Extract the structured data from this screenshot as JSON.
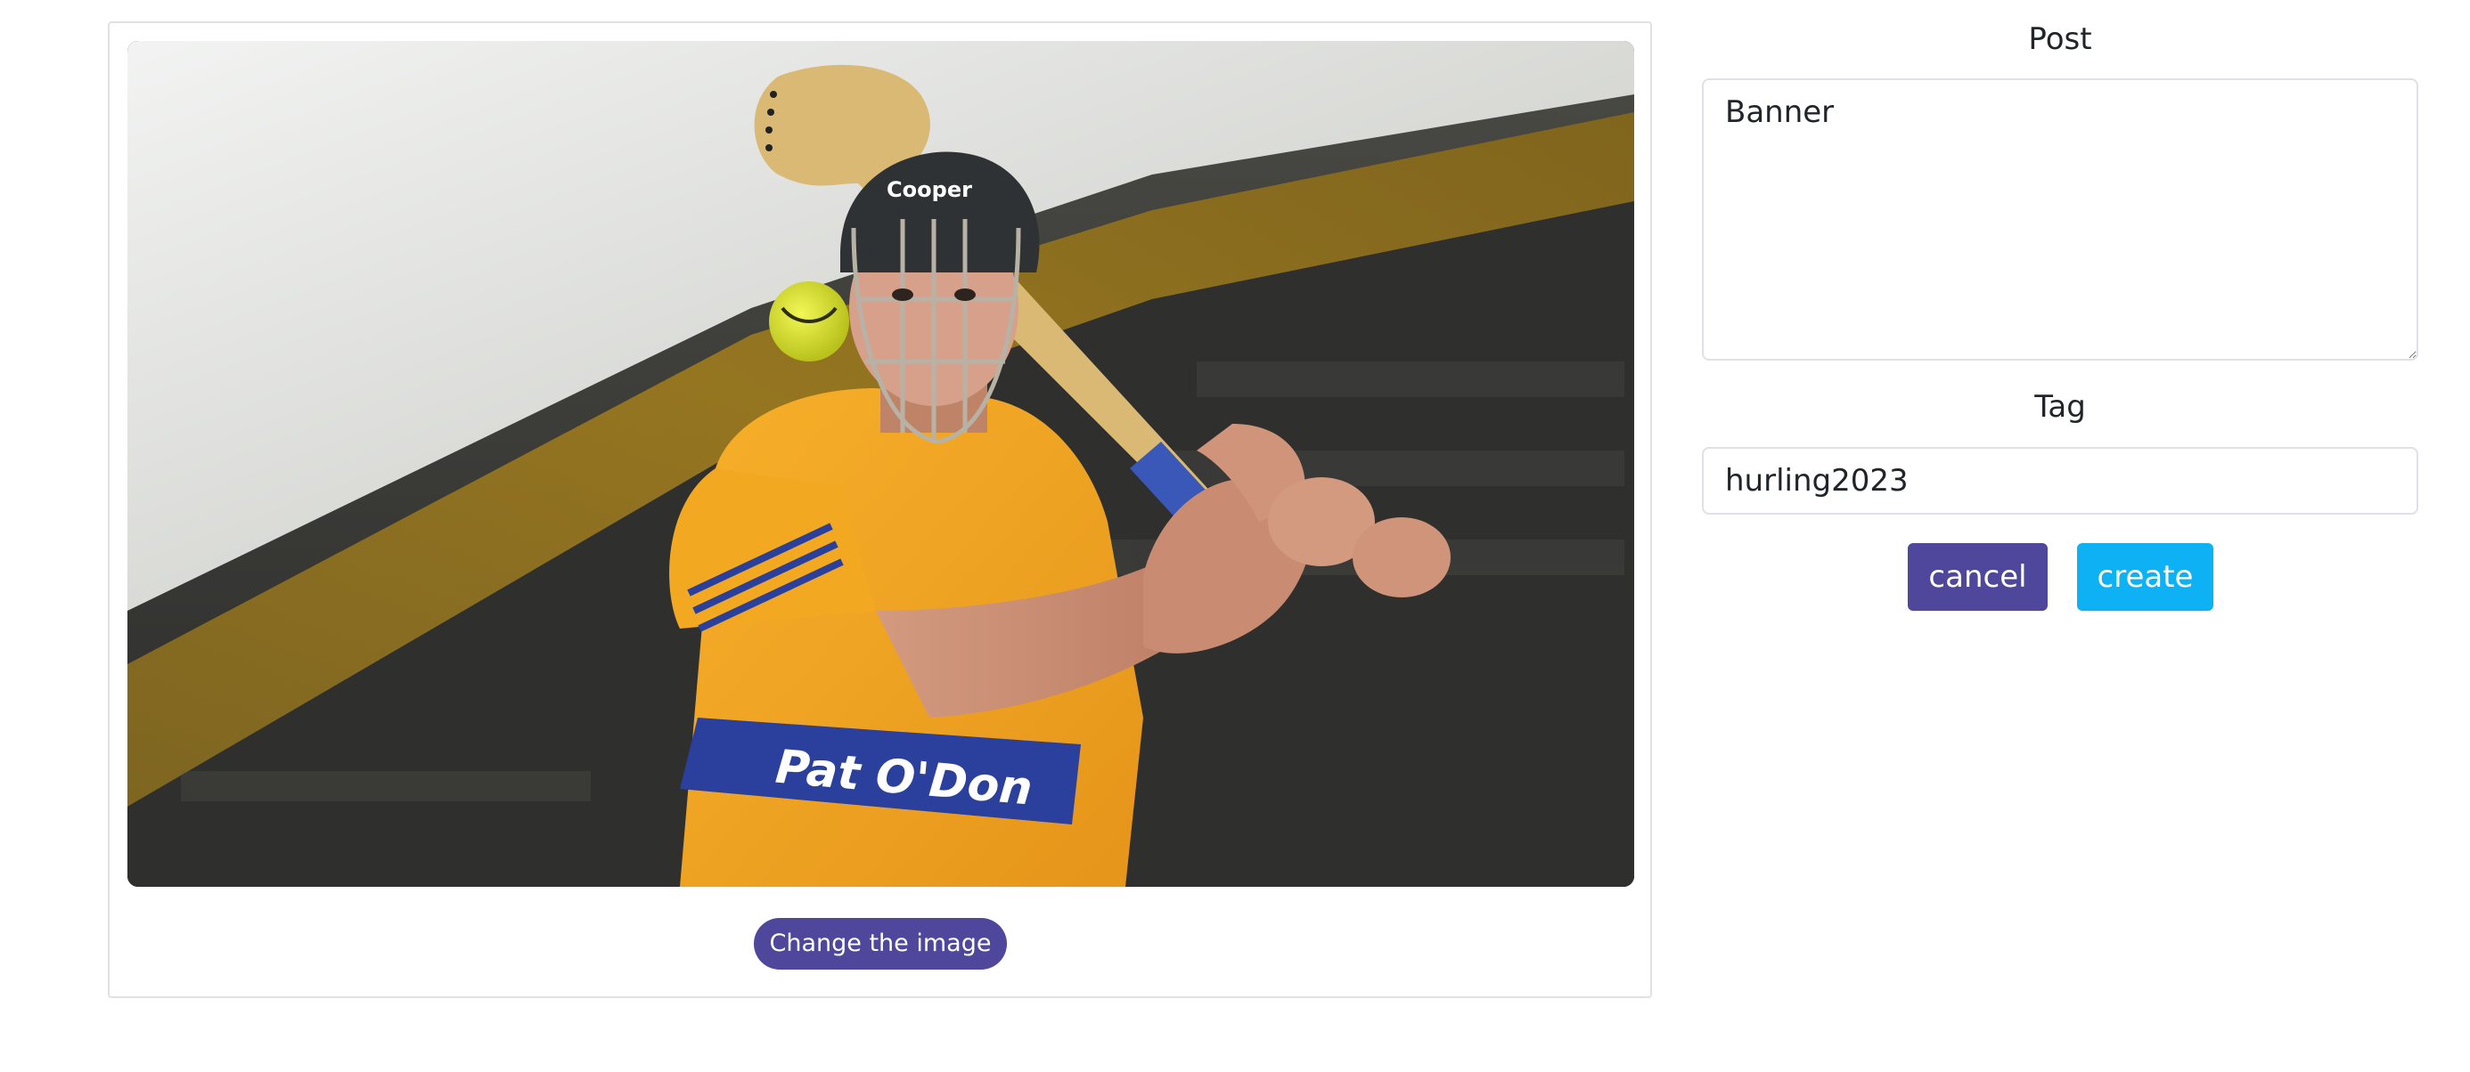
{
  "image_panel": {
    "photo_alt": "Hurler in yellow jersey with helmet swinging a hurley at a sliotar",
    "jersey_text": "Pat O'Don",
    "helmet_text": "Cooper",
    "change_image_label": "Change the image"
  },
  "form": {
    "post_label": "Post",
    "post_value": "Banner",
    "tag_label": "Tag",
    "tag_value": "hurling2023",
    "cancel_label": "cancel",
    "create_label": "create"
  },
  "colors": {
    "primary": "#4e479b",
    "accent": "#0db1f4",
    "border": "#dee2e6",
    "jersey": "#f5a623",
    "jersey_band": "#2b3f9c"
  }
}
